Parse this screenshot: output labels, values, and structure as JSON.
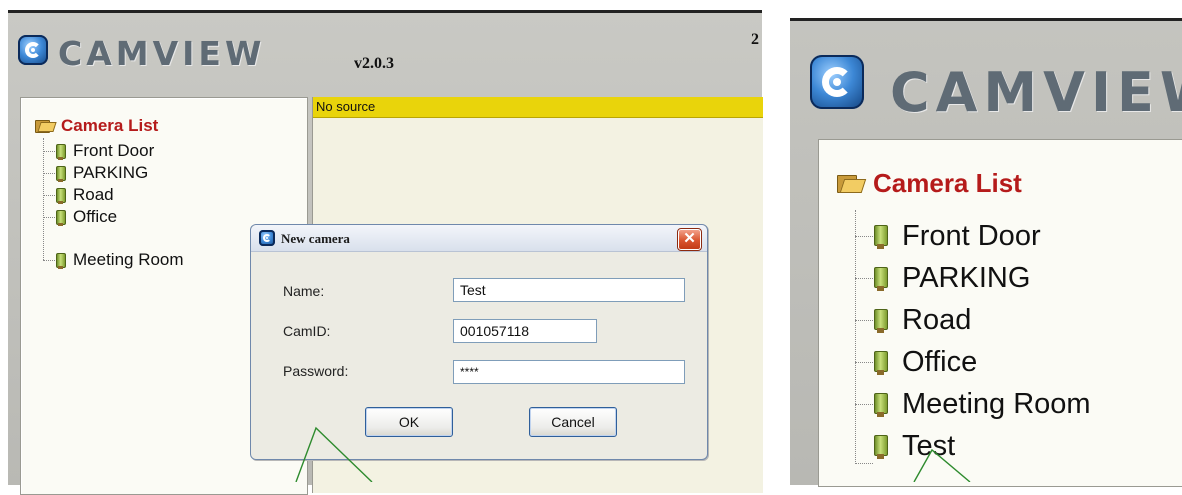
{
  "app": {
    "brand": "CAMVIEW",
    "version": "v2.0.3",
    "edge_text": "2"
  },
  "camera_list": {
    "title": "Camera List",
    "items": [
      "Front Door",
      "PARKING",
      "Road",
      "Office",
      "Meeting Room"
    ]
  },
  "video": {
    "status": "No source"
  },
  "dialog": {
    "title": "New camera",
    "close_symbol": "✕",
    "name_label": "Name:",
    "name_value": "Test",
    "camid_label": "CamID:",
    "camid_value": "001057118",
    "password_label": "Password:",
    "password_value": "****",
    "ok_label": "OK",
    "cancel_label": "Cancel"
  },
  "zoom": {
    "brand": "CAMVIEW",
    "title": "Camera List",
    "items": [
      "Front Door",
      "PARKING",
      "Road",
      "Office",
      "Meeting Room",
      "Test"
    ]
  },
  "colors": {
    "accent_red": "#b51b1b",
    "status_yellow": "#e9d40b",
    "chrome_grey": "#c9c9c4",
    "arrow_green": "#2e8b2e"
  },
  "icons": [
    "camview-logo-icon",
    "folder-icon",
    "camera-icon",
    "close-icon"
  ]
}
